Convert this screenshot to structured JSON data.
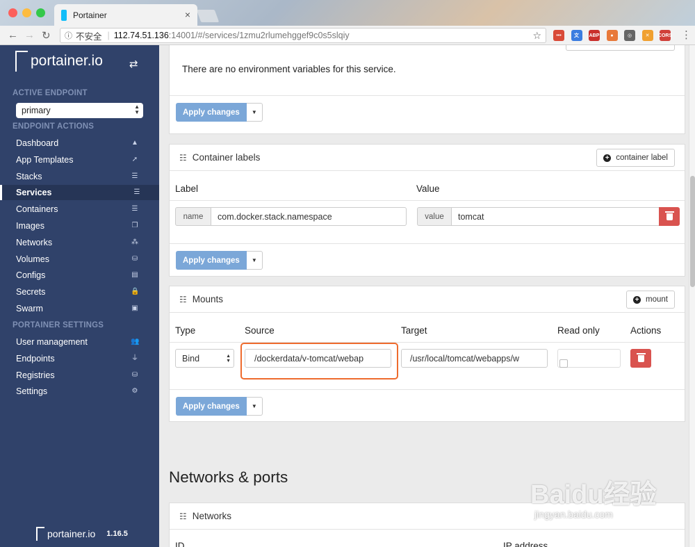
{
  "browser": {
    "tab_title": "Portainer",
    "insecure_label": "不安全",
    "url_host": "112.74.51.136",
    "url_path": ":14001/#/services/1zmu2rlumehggef9c0s5slqiy",
    "extensions": [
      {
        "name": "ext-1",
        "color": "#d94a38",
        "label": "•••"
      },
      {
        "name": "ext-2",
        "color": "#3b7de0",
        "label": "文"
      },
      {
        "name": "ext-3",
        "color": "#c9302c",
        "label": "ABP"
      },
      {
        "name": "ext-4",
        "color": "#e8793a",
        "label": "●"
      },
      {
        "name": "ext-5",
        "color": "#666666",
        "label": "◎"
      },
      {
        "name": "ext-6",
        "color": "#f0a030",
        "label": "✕"
      },
      {
        "name": "ext-7",
        "color": "#d0403a",
        "label": "CORS"
      }
    ]
  },
  "sidebar": {
    "logo_text": "portainer.io",
    "active_endpoint_title": "ACTIVE ENDPOINT",
    "endpoint_selected": "primary",
    "endpoint_actions_title": "ENDPOINT ACTIONS",
    "items": [
      {
        "label": "Dashboard",
        "icon": "▲"
      },
      {
        "label": "App Templates",
        "icon": "➚"
      },
      {
        "label": "Stacks",
        "icon": "☰"
      },
      {
        "label": "Services",
        "icon": "☰"
      },
      {
        "label": "Containers",
        "icon": "☰"
      },
      {
        "label": "Images",
        "icon": "❐"
      },
      {
        "label": "Networks",
        "icon": "⁂"
      },
      {
        "label": "Volumes",
        "icon": "⛁"
      },
      {
        "label": "Configs",
        "icon": "▤"
      },
      {
        "label": "Secrets",
        "icon": "🔒"
      },
      {
        "label": "Swarm",
        "icon": "▣"
      }
    ],
    "settings_title": "PORTAINER SETTINGS",
    "settings_items": [
      {
        "label": "User management",
        "icon": "👥"
      },
      {
        "label": "Endpoints",
        "icon": "⏚"
      },
      {
        "label": "Registries",
        "icon": "⛁"
      },
      {
        "label": "Settings",
        "icon": "⚙"
      }
    ],
    "footer_logo": "portainer.io",
    "version": "1.16.5"
  },
  "env_panel": {
    "message": "There are no environment variables for this service.",
    "apply_label": "Apply changes"
  },
  "labels_panel": {
    "title": "Container labels",
    "add_button": "container label",
    "col_label": "Label",
    "col_value": "Value",
    "name_addon": "name",
    "name_value": "com.docker.stack.namespace",
    "value_addon": "value",
    "value_value": "tomcat",
    "apply_label": "Apply changes"
  },
  "mounts_panel": {
    "title": "Mounts",
    "add_button": "mount",
    "col_type": "Type",
    "col_source": "Source",
    "col_target": "Target",
    "col_readonly": "Read only",
    "col_actions": "Actions",
    "type_value": "Bind",
    "source_value": "/dockerdata/v-tomcat/webap",
    "target_value": "/usr/local/tomcat/webapps/w",
    "read_only": false,
    "apply_label": "Apply changes"
  },
  "networks_section": {
    "heading": "Networks & ports",
    "panel_title": "Networks",
    "col_id": "ID",
    "col_ip": "IP address"
  },
  "watermark": {
    "text": "Baidu经验",
    "sub": "jingyan.baidu.com"
  },
  "colors": {
    "sidebar_bg": "#30426a",
    "apply_btn": "#7ba7d8",
    "danger": "#d9534f",
    "highlight": "#ee6b2d"
  }
}
